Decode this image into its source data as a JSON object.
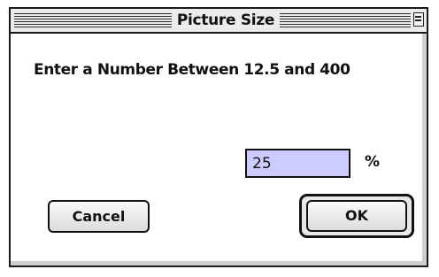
{
  "dialog": {
    "title": "Picture Size",
    "prompt": "Enter a Number Between 12.5 and 400",
    "input_value": "25",
    "unit": "%",
    "cancel_label": "Cancel",
    "ok_label": "OK"
  },
  "colors": {
    "input_highlight": "#ccccff",
    "titlebar": "#ececec",
    "frame": "#1a1a1a"
  },
  "icons": {
    "collapse": "collapse-box-icon"
  }
}
